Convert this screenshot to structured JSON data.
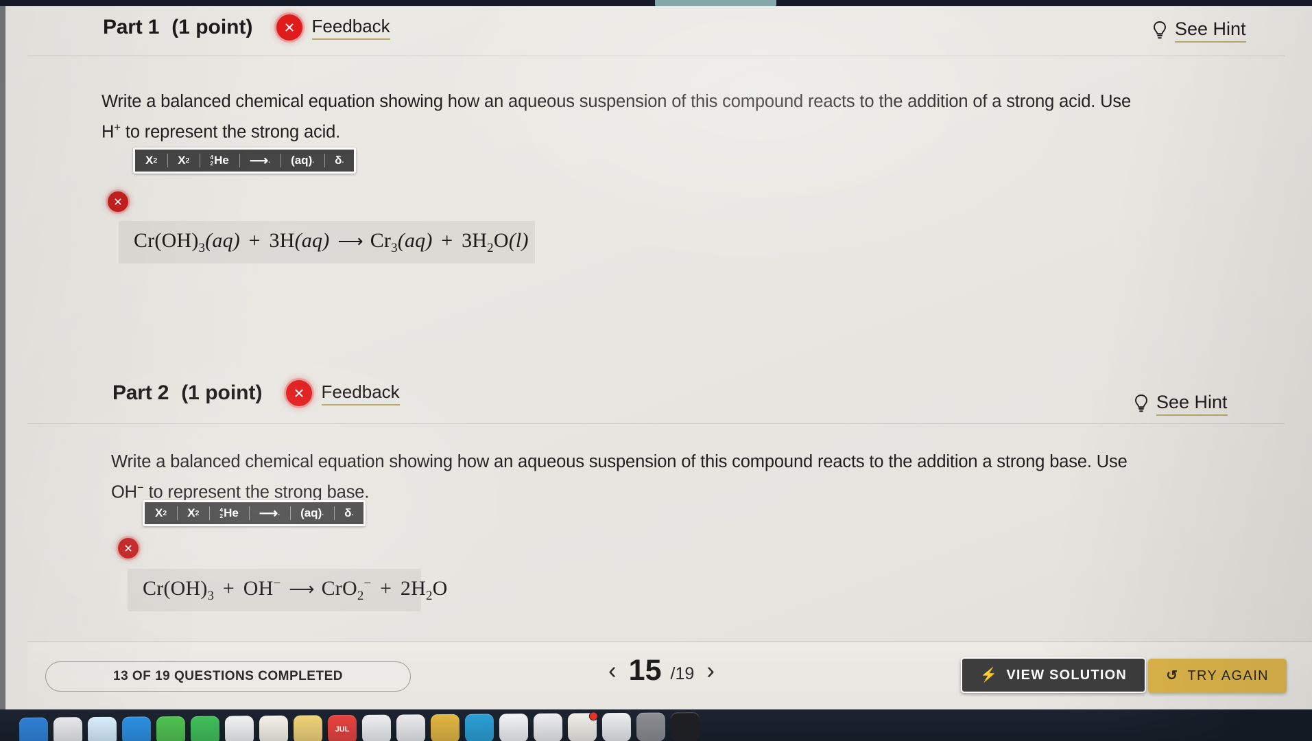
{
  "parts": [
    {
      "title": "Part 1",
      "points": "(1 point)",
      "feedback_label": "Feedback",
      "status_icon": "error-x-icon",
      "hint_label": "See Hint",
      "hint_icon": "lightbulb-icon",
      "prompt_line1": "Write a balanced chemical equation showing how an aqueous suspension of this compound reacts to the addition of a strong acid. Use",
      "prompt_line2_pre": "H",
      "prompt_line2_sup": "+",
      "prompt_line2_post": " to represent the strong acid.",
      "toolbar": {
        "superscript_label": "X",
        "superscript_mark": "2",
        "subscript_label": "X",
        "subscript_mark": "2",
        "isotope_mass": "4",
        "isotope_atomic": "2",
        "isotope_label": "He",
        "arrow_label": "⟶",
        "phase_label": "(aq)",
        "delta_label": "δ"
      },
      "answer": {
        "error_icon": "error-x-icon",
        "equation_plain": "Cr(OH)3(aq) + 3H(aq) ⟶ Cr3(aq) + 3H2O(l)",
        "tokens": [
          {
            "t": "Cr(OH)"
          },
          {
            "t": "3",
            "s": "sub"
          },
          {
            "t": "(",
            "i": true
          },
          {
            "t": "aq",
            "i": true
          },
          {
            "t": ")",
            "i": true
          },
          {
            "t": " + ",
            "cls": "plus"
          },
          {
            "t": "3H"
          },
          {
            "t": "(",
            "i": true
          },
          {
            "t": "aq",
            "i": true
          },
          {
            "t": ")",
            "i": true
          },
          {
            "t": "⟶",
            "cls": "rarrow"
          },
          {
            "t": "Cr"
          },
          {
            "t": "3",
            "s": "sub"
          },
          {
            "t": "(",
            "i": true
          },
          {
            "t": "aq",
            "i": true
          },
          {
            "t": ")",
            "i": true
          },
          {
            "t": " + ",
            "cls": "plus"
          },
          {
            "t": "3H"
          },
          {
            "t": "2",
            "s": "sub"
          },
          {
            "t": "O"
          },
          {
            "t": "(",
            "i": true
          },
          {
            "t": "l",
            "i": true
          },
          {
            "t": ")",
            "i": true
          }
        ]
      }
    },
    {
      "title": "Part 2",
      "points": "(1 point)",
      "feedback_label": "Feedback",
      "status_icon": "error-x-icon",
      "hint_label": "See Hint",
      "hint_icon": "lightbulb-icon",
      "prompt_line1": "Write a balanced chemical equation showing how an aqueous suspension of this compound reacts to the addition a strong base. Use",
      "prompt_line2_pre": "OH",
      "prompt_line2_sup": "−",
      "prompt_line2_post": " to represent the strong base.",
      "toolbar": {
        "superscript_label": "X",
        "superscript_mark": "2",
        "subscript_label": "X",
        "subscript_mark": "2",
        "isotope_mass": "4",
        "isotope_atomic": "2",
        "isotope_label": "He",
        "arrow_label": "⟶",
        "phase_label": "(aq)",
        "delta_label": "δ"
      },
      "answer": {
        "error_icon": "error-x-icon",
        "equation_plain": "Cr(OH)3 + OH− ⟶ CrO2− + 2H2O",
        "tokens": [
          {
            "t": "Cr(OH)"
          },
          {
            "t": "3",
            "s": "sub"
          },
          {
            "t": " + ",
            "cls": "plus"
          },
          {
            "t": "OH"
          },
          {
            "t": "−",
            "s": "sup"
          },
          {
            "t": "⟶",
            "cls": "rarrow"
          },
          {
            "t": "CrO"
          },
          {
            "t": "2",
            "s": "sub"
          },
          {
            "t": "−",
            "s": "sup"
          },
          {
            "t": " + ",
            "cls": "plus"
          },
          {
            "t": "2H"
          },
          {
            "t": "2",
            "s": "sub"
          },
          {
            "t": "O"
          }
        ]
      }
    }
  ],
  "footer": {
    "progress_label": "13 OF 19 QUESTIONS COMPLETED",
    "prev_icon": "chevron-left-icon",
    "next_icon": "chevron-right-icon",
    "current_page": "15",
    "page_total": "/19",
    "view_solution_label": "VIEW SOLUTION",
    "view_solution_icon": "bolt-icon",
    "try_again_label": "TRY AGAIN",
    "try_again_icon": "refresh-icon"
  },
  "colors": {
    "error_red": "#e01b1b",
    "hint_underline": "#b9a86a",
    "try_again_gold": "#dcb44a",
    "view_solution_dark": "#3d3d3d",
    "toolbar_dark": "#454545",
    "page_bg": "#eceae5"
  },
  "dock": {
    "icons": [
      {
        "name": "finder-icon",
        "color": "#2e7fd4",
        "accent": "#eef4fb"
      },
      {
        "name": "launchpad-icon",
        "color": "#e8e8ea",
        "accent": "#d33"
      },
      {
        "name": "safari-icon",
        "color": "#d8edfb",
        "accent": "#2f7fd4"
      },
      {
        "name": "mail-icon",
        "color": "#2b8fe0",
        "accent": "#fff"
      },
      {
        "name": "messages-icon",
        "color": "#4fc14f",
        "accent": "#fff"
      },
      {
        "name": "facetime-icon",
        "color": "#3fbf58",
        "accent": "#fff"
      },
      {
        "name": "photos-icon",
        "color": "#f2f2f2",
        "accent": "#e8b"
      },
      {
        "name": "maps-icon",
        "color": "#f5f2e8",
        "accent": "#e06"
      },
      {
        "name": "notes-icon",
        "color": "#f0d277",
        "accent": "#8a6b1d"
      },
      {
        "name": "music-icon",
        "color": "#e8413d",
        "accent": "#fff",
        "label": "JUL"
      },
      {
        "name": "podcasts-icon",
        "color": "#efeff1",
        "accent": "#8a4fd4"
      },
      {
        "name": "tv-icon",
        "color": "#ebebed",
        "accent": "#222"
      },
      {
        "name": "reminders-icon",
        "color": "#e3b640",
        "accent": "#fff"
      },
      {
        "name": "calendar-icon",
        "color": "#2a9fd6",
        "accent": "#fff"
      },
      {
        "name": "appstore-icon",
        "color": "#f4f4f6",
        "accent": "#d33"
      },
      {
        "name": "numbers-icon",
        "color": "#eeeef0",
        "accent": "#49a34b"
      },
      {
        "name": "keynote-icon",
        "color": "#f2efe8",
        "accent": "#d0402a",
        "badge": true
      },
      {
        "name": "pages-icon",
        "color": "#ededef",
        "accent": "#e06"
      },
      {
        "name": "settings-icon",
        "color": "#8d8d92",
        "accent": "#fff"
      },
      {
        "name": "terminal-icon",
        "color": "#1f1f22",
        "accent": "#6f6"
      }
    ]
  }
}
